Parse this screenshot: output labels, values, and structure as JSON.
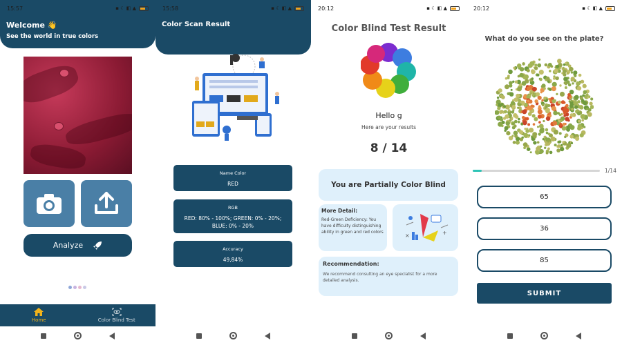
{
  "screen1": {
    "status_time": "15:57",
    "welcome": "Welcome 👋",
    "tagline": "See the world in true colors",
    "analyze_label": "Analyze",
    "tabs": [
      {
        "label": "Home",
        "icon": "home-icon"
      },
      {
        "label": "Color Blind Test",
        "icon": "eye-scan-icon"
      }
    ]
  },
  "screen2": {
    "status_time": "15:58",
    "title": "Color Scan Result",
    "cards": [
      {
        "label": "Name Color",
        "value": "RED"
      },
      {
        "label": "RGB",
        "value": "RED: 80% - 100%; GREEN: 0% - 20%; BLUE: 0% - 20%"
      },
      {
        "label": "Accuracy",
        "value": "49,84%"
      }
    ]
  },
  "screen3": {
    "status_time": "20:12",
    "title": "Color Blind Test Result",
    "greeting": "Hello g",
    "subtitle": "Here are your results",
    "score": "8 / 14",
    "verdict": "You are Partially Color Blind",
    "more_title": "More Detail:",
    "more_text": "Red-Green Deficiency: You have difficulty distinguishing ability in green and red colors",
    "rec_title": "Recommendation:",
    "rec_text": "We recommend consulting an eye specialist for a more detailed analysis."
  },
  "screen4": {
    "status_time": "20:12",
    "question": "What do you see on the plate?",
    "progress_fraction": 0.07,
    "progress_label": "1/14",
    "options": [
      "65",
      "36",
      "85"
    ],
    "submit_label": "SUBMIT"
  },
  "colors": {
    "primary": "#1a4a66",
    "tile": "#4a7fa6",
    "accent": "#f2b31b",
    "light": "#dff0fb"
  }
}
